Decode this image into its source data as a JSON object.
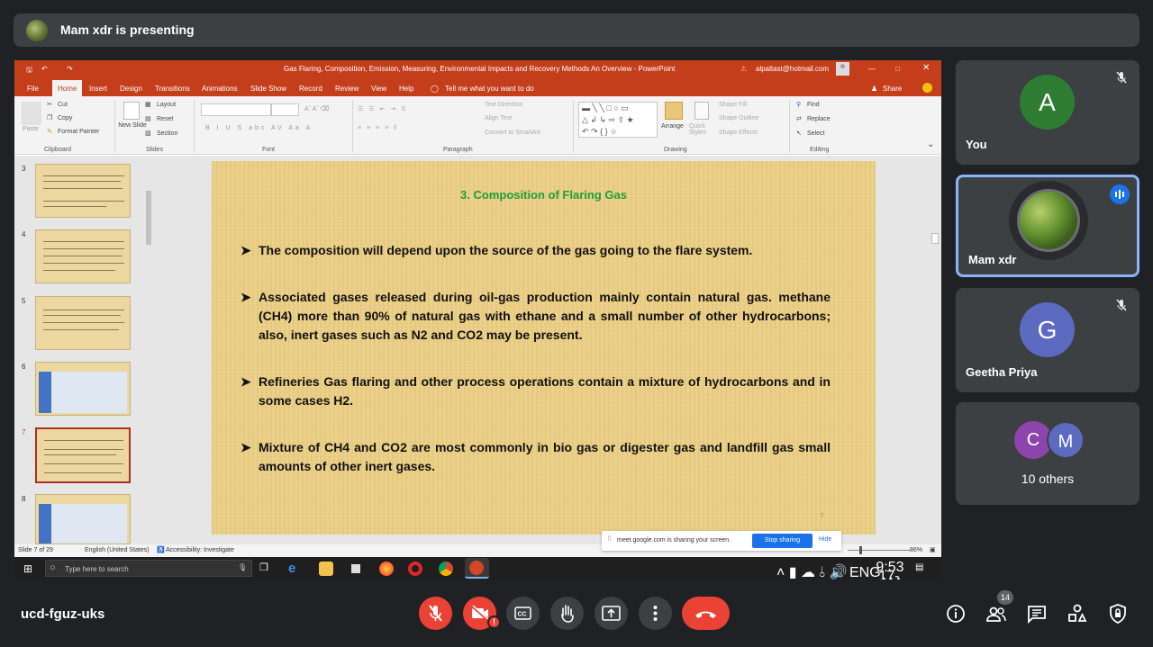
{
  "presenting": {
    "text": "Mam xdr is presenting"
  },
  "ppt": {
    "window_title": "Gas Flaring, Composition, Emission, Measuring, Environmental Impacts and Recovery Methods An Overview  -  PowerPoint",
    "account": "alpaltast@hotmail.com",
    "menu": [
      "File",
      "Home",
      "Insert",
      "Design",
      "Transitions",
      "Animations",
      "Slide Show",
      "Record",
      "Review",
      "View",
      "Help"
    ],
    "tell_me": "Tell me what you want to do",
    "share": "Share",
    "ribbon": {
      "clipboard": {
        "cut": "Cut",
        "copy": "Copy",
        "format_painter": "Format Painter",
        "paste": "Paste",
        "label": "Clipboard"
      },
      "slides": {
        "new_slide": "New Slide",
        "layout": "Layout",
        "reset": "Reset",
        "section": "Section",
        "label": "Slides"
      },
      "font": {
        "label": "Font"
      },
      "paragraph": {
        "text_direction": "Text Direction",
        "align_text": "Align Text",
        "convert": "Convert to SmartArt",
        "label": "Paragraph"
      },
      "drawing": {
        "arrange": "Arrange",
        "quick_styles": "Quick Styles",
        "shape_fill": "Shape Fill",
        "shape_outline": "Shape Outline",
        "shape_effects": "Shape Effects",
        "label": "Drawing"
      },
      "editing": {
        "find": "Find",
        "replace": "Replace",
        "select": "Select",
        "label": "Editing"
      }
    },
    "thumb_numbers": [
      "3",
      "4",
      "5",
      "6",
      "7",
      "8"
    ],
    "slide": {
      "title": "3. Composition of Flaring Gas",
      "bullets": [
        "The composition will depend upon the source of the gas going to the flare system.",
        "Associated gases released during oil-gas production mainly contain natural gas. methane (CH4) more than 90% of natural gas with ethane and a small number of other hydrocarbons; also, inert gases such as N2 and CO2 may be present.",
        "Refineries Gas flaring and other process operations contain a mixture of hydrocarbons and in some cases H2.",
        " Mixture of CH4 and CO2 are most commonly in bio gas or digester gas and landfill gas small amounts of other inert gases."
      ],
      "number": "7"
    },
    "status": {
      "slide_of": "Slide 7 of 29",
      "language": "English (United States)",
      "accessibility": "Accessibility: Investigate",
      "zoom": "86%"
    },
    "share_popup": {
      "text": "meet.google.com is sharing your screen.",
      "stop": "Stop sharing",
      "hide": "Hide"
    },
    "taskbar": {
      "search_placeholder": "Type here to search",
      "lang": "ENG",
      "time": "9:53 AM",
      "date": "17-Nov-21"
    }
  },
  "participants": [
    {
      "name": "You",
      "initial": "A",
      "color": "#2e7d32"
    },
    {
      "name": "Mam xdr"
    },
    {
      "name": "Geetha Priya",
      "initial": "G",
      "color": "#5c6bc0"
    },
    {
      "name": "10 others",
      "initials": [
        "C",
        "M"
      ],
      "colors": [
        "#8e44ad",
        "#5c6bc0"
      ]
    }
  ],
  "meeting": {
    "code": "ucd-fguz-uks",
    "people_count": "14"
  }
}
